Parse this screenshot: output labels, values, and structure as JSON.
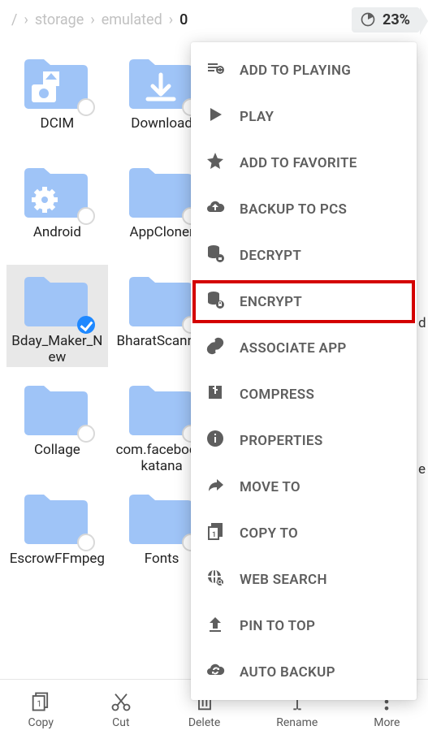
{
  "breadcrumb": {
    "root": "/",
    "parts": [
      "storage",
      "emulated",
      "0"
    ]
  },
  "storage": {
    "percent_label": "23%"
  },
  "folders": [
    {
      "name": "DCIM",
      "overlay": "camera",
      "selected": false
    },
    {
      "name": "Download",
      "overlay": "download",
      "selected": false
    },
    {
      "name": "Android",
      "overlay": "gear",
      "selected": false
    },
    {
      "name": "AppCloner",
      "overlay": "",
      "selected": false
    },
    {
      "name": "Bday_Maker_New",
      "overlay": "",
      "selected": true
    },
    {
      "name": "BharatScanner",
      "overlay": "",
      "selected": false
    },
    {
      "name": "Collage",
      "overlay": "",
      "selected": false
    },
    {
      "name": "com.facebook.katana",
      "overlay": "",
      "selected": false
    },
    {
      "name": "EscrowFFmpeg",
      "overlay": "",
      "selected": false
    },
    {
      "name": "Fonts",
      "overlay": "",
      "selected": false
    }
  ],
  "peek_labels": [
    "d",
    "e"
  ],
  "context_menu": [
    {
      "icon": "playlist-add",
      "label": "ADD TO PLAYING"
    },
    {
      "icon": "play",
      "label": "PLAY"
    },
    {
      "icon": "star",
      "label": "ADD TO FAVORITE"
    },
    {
      "icon": "cloud-up",
      "label": "BACKUP TO PCS"
    },
    {
      "icon": "db-unlock",
      "label": "DECRYPT"
    },
    {
      "icon": "db-lock",
      "label": "ENCRYPT",
      "highlight": true
    },
    {
      "icon": "link",
      "label": "ASSOCIATE APP"
    },
    {
      "icon": "archive",
      "label": "COMPRESS"
    },
    {
      "icon": "info",
      "label": "PROPERTIES"
    },
    {
      "icon": "forward",
      "label": "MOVE TO"
    },
    {
      "icon": "copy-page",
      "label": "COPY TO"
    },
    {
      "icon": "globe-search",
      "label": "WEB SEARCH"
    },
    {
      "icon": "pin-up",
      "label": "PIN TO TOP"
    },
    {
      "icon": "cloud-sync",
      "label": "AUTO BACKUP"
    }
  ],
  "toolbar": {
    "copy": "Copy",
    "cut": "Cut",
    "delete": "Delete",
    "rename": "Rename",
    "more": "More"
  }
}
